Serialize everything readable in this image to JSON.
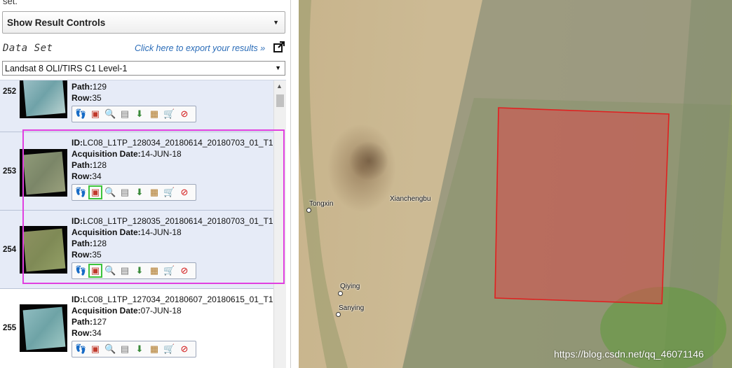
{
  "sidebar": {
    "top_text": "set.",
    "result_controls": {
      "label": "Show Result Controls"
    },
    "dataset_title": "Data Set",
    "export_link": "Click here to export your results »",
    "dataset_select": {
      "value": "Landsat 8 OLI/TIRS C1 Level-1"
    },
    "rows": [
      {
        "num": "252",
        "id_label": "",
        "id": "",
        "date_label": "",
        "date": "",
        "path_label": "Path:",
        "path": "129",
        "row_label": "Row:",
        "row": "35"
      },
      {
        "num": "253",
        "id_label": "ID:",
        "id": "LC08_L1TP_128034_20180614_20180703_01_T1",
        "date_label": "Acquisition Date:",
        "date": "14-JUN-18",
        "path_label": "Path:",
        "path": "128",
        "row_label": "Row:",
        "row": "34"
      },
      {
        "num": "254",
        "id_label": "ID:",
        "id": "LC08_L1TP_128035_20180614_20180703_01_T1",
        "date_label": "Acquisition Date:",
        "date": "14-JUN-18",
        "path_label": "Path:",
        "path": "128",
        "row_label": "Row:",
        "row": "35"
      },
      {
        "num": "255",
        "id_label": "ID:",
        "id": "LC08_L1TP_127034_20180607_20180615_01_T1",
        "date_label": "Acquisition Date:",
        "date": "07-JUN-18",
        "path_label": "Path:",
        "path": "127",
        "row_label": "Row:",
        "row": "34"
      }
    ],
    "toolbar_icons": [
      "footprint-icon",
      "browse-overlay-icon",
      "metadata-icon",
      "compare-icon",
      "download-icon",
      "bulk-download-icon",
      "cart-icon",
      "exclude-icon"
    ]
  },
  "map": {
    "labels": [
      "Tongxin",
      "Xianchengbu",
      "Qiying",
      "Sanying"
    ],
    "watermark": "https://blog.csdn.net/qq_46071146"
  },
  "colors": {
    "link": "#2a6cb8",
    "selected_row": "#e6ebf7",
    "highlight_box": "#e040e0",
    "footprint_fill": "#d94a4a",
    "footprint_stroke": "#e02020"
  }
}
